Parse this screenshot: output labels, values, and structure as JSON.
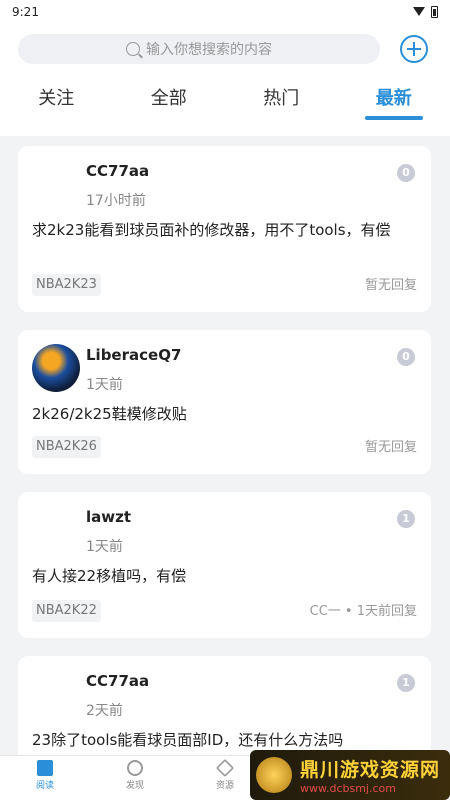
{
  "status": {
    "time": "9:21"
  },
  "search": {
    "placeholder": "输入你想搜索的内容"
  },
  "tabs": [
    {
      "label": "关注",
      "active": false
    },
    {
      "label": "全部",
      "active": false
    },
    {
      "label": "热门",
      "active": false
    },
    {
      "label": "最新",
      "active": true
    }
  ],
  "posts": [
    {
      "author": "CC77aa",
      "time": "17小时前",
      "count": "0",
      "content": "求2k23能看到球员面补的修改器，用不了tools，有偿",
      "tag": "NBA2K23",
      "reply": "暂无回复"
    },
    {
      "author": "LiberaceQ7",
      "time": "1天前",
      "count": "0",
      "content": "2k26/2k25鞋模修改贴",
      "tag": "NBA2K26",
      "reply": "暂无回复"
    },
    {
      "author": "lawzt",
      "time": "1天前",
      "count": "1",
      "content": "有人接22移植吗，有偿",
      "tag": "NBA2K22",
      "reply": "CC一 • 1天前回复"
    },
    {
      "author": "CC77aa",
      "time": "2天前",
      "count": "1",
      "content": "23除了tools能看球员面部ID，还有什么方法吗",
      "tag": "",
      "reply": ""
    }
  ],
  "nav": [
    {
      "label": "阅读",
      "icon": "read-icon",
      "active": true
    },
    {
      "label": "发现",
      "icon": "discover-icon",
      "active": false
    },
    {
      "label": "资源",
      "icon": "resource-icon",
      "active": false
    }
  ],
  "watermark": {
    "title": "鼎川游戏资源网",
    "url": "www.dcbsmj.com"
  },
  "colors": {
    "accent": "#2a8fd8",
    "badge": "#c8cad6"
  }
}
